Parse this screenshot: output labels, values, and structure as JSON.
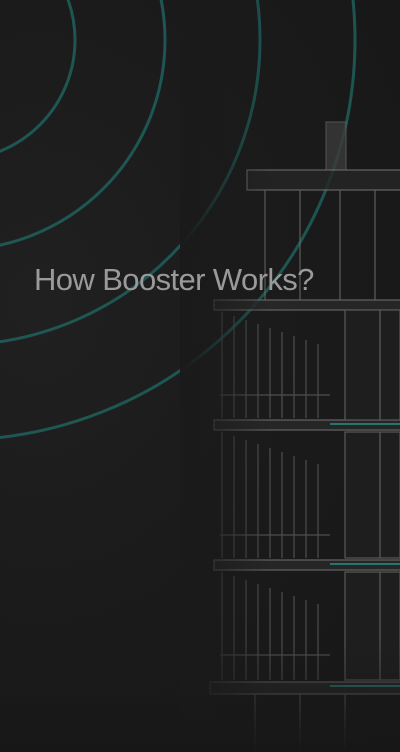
{
  "hero": {
    "heading": "How Booster Works?",
    "illustration": "building-with-signal-waves",
    "colors": {
      "background": "#1b1b1b",
      "heading": "#9a9a9a",
      "signal_ring": "#1f6f6a",
      "building_line": "#8a8a8a",
      "floor_accent": "#2a8e86"
    }
  }
}
